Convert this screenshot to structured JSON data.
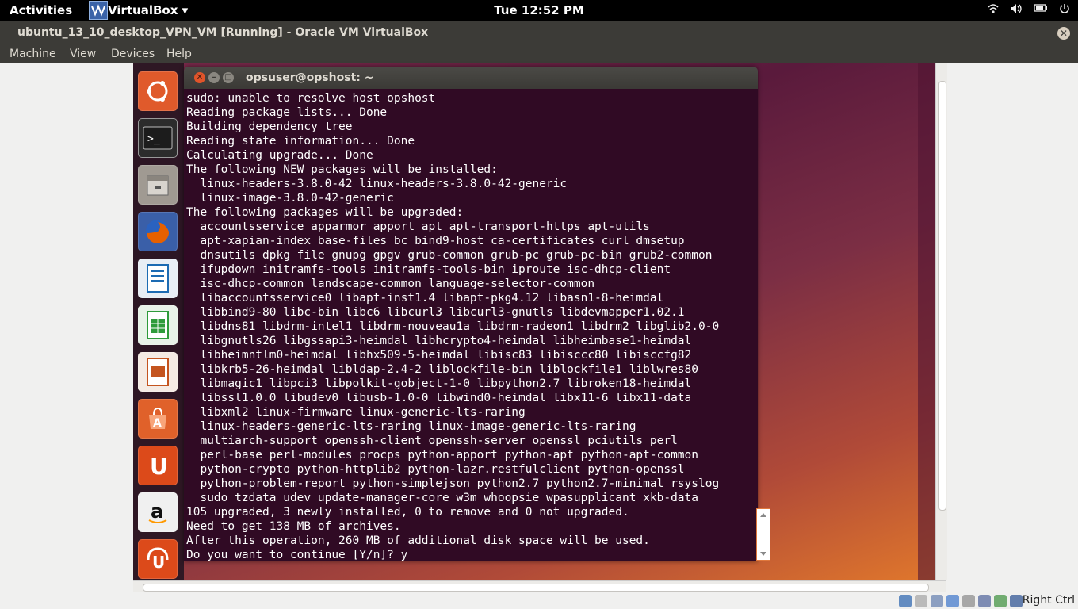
{
  "top_panel": {
    "activities": "Activities",
    "app_menu": "VirtualBox ▾",
    "clock": "Tue 12:52 PM",
    "tray_icons": [
      "wifi-icon",
      "volume-icon",
      "battery-icon",
      "power-icon"
    ]
  },
  "window": {
    "title": "ubuntu_13_10_desktop_VPN_VM [Running] - Oracle VM VirtualBox",
    "close_glyph": "✕"
  },
  "menu": {
    "items": [
      "Machine",
      "View",
      "Devices",
      "Help"
    ]
  },
  "launcher": {
    "items": [
      {
        "name": "ubuntu-dash-icon",
        "color": "#e05a2b"
      },
      {
        "name": "terminal-icon",
        "color": "#3a3a3a"
      },
      {
        "name": "files-icon",
        "color": "#8a8580"
      },
      {
        "name": "firefox-icon",
        "color": "#e66000"
      },
      {
        "name": "libreoffice-writer-icon",
        "color": "#1c6bb3"
      },
      {
        "name": "libreoffice-calc-icon",
        "color": "#2e9b3a"
      },
      {
        "name": "libreoffice-impress-icon",
        "color": "#c4541f"
      },
      {
        "name": "software-center-icon",
        "color": "#e0612a"
      },
      {
        "name": "ubuntu-one-icon",
        "color": "#dc4a1a"
      },
      {
        "name": "amazon-icon",
        "color": "#f0f0f0"
      },
      {
        "name": "ubuntu-one-music-icon",
        "color": "#dc4a1a"
      }
    ]
  },
  "terminal": {
    "title": "opsuser@opshost: ~",
    "lines": [
      "sudo: unable to resolve host opshost",
      "Reading package lists... Done",
      "Building dependency tree",
      "Reading state information... Done",
      "Calculating upgrade... Done",
      "The following NEW packages will be installed:",
      "  linux-headers-3.8.0-42 linux-headers-3.8.0-42-generic",
      "  linux-image-3.8.0-42-generic",
      "The following packages will be upgraded:",
      "  accountsservice apparmor apport apt apt-transport-https apt-utils",
      "  apt-xapian-index base-files bc bind9-host ca-certificates curl dmsetup",
      "  dnsutils dpkg file gnupg gpgv grub-common grub-pc grub-pc-bin grub2-common",
      "  ifupdown initramfs-tools initramfs-tools-bin iproute isc-dhcp-client",
      "  isc-dhcp-common landscape-common language-selector-common",
      "  libaccountsservice0 libapt-inst1.4 libapt-pkg4.12 libasn1-8-heimdal",
      "  libbind9-80 libc-bin libc6 libcurl3 libcurl3-gnutls libdevmapper1.02.1",
      "  libdns81 libdrm-intel1 libdrm-nouveau1a libdrm-radeon1 libdrm2 libglib2.0-0",
      "  libgnutls26 libgssapi3-heimdal libhcrypto4-heimdal libheimbase1-heimdal",
      "  libheimntlm0-heimdal libhx509-5-heimdal libisc83 libisccc80 libisccfg82",
      "  libkrb5-26-heimdal libldap-2.4-2 liblockfile-bin liblockfile1 liblwres80",
      "  libmagic1 libpci3 libpolkit-gobject-1-0 libpython2.7 libroken18-heimdal",
      "  libssl1.0.0 libudev0 libusb-1.0-0 libwind0-heimdal libx11-6 libx11-data",
      "  libxml2 linux-firmware linux-generic-lts-raring",
      "  linux-headers-generic-lts-raring linux-image-generic-lts-raring",
      "  multiarch-support openssh-client openssh-server openssl pciutils perl",
      "  perl-base perl-modules procps python-apport python-apt python-apt-common",
      "  python-crypto python-httplib2 python-lazr.restfulclient python-openssl",
      "  python-problem-report python-simplejson python2.7 python2.7-minimal rsyslog",
      "  sudo tzdata udev update-manager-core w3m whoopsie wpasupplicant xkb-data",
      "105 upgraded, 3 newly installed, 0 to remove and 0 not upgraded.",
      "Need to get 138 MB of archives.",
      "After this operation, 260 MB of additional disk space will be used.",
      "Do you want to continue [Y/n]? y"
    ]
  },
  "statusbar": {
    "host_key": "Right Ctrl"
  },
  "colors": {
    "terminal_bg": "#300a24",
    "panel": "#000000",
    "titlebar": "#3c3b37",
    "close_btn": "#e0542a"
  }
}
